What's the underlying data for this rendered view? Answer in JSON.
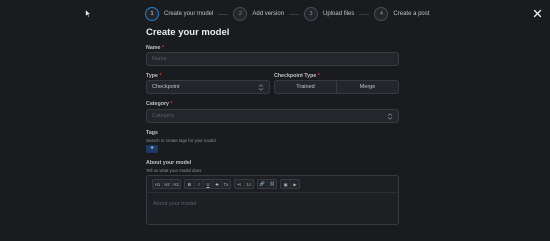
{
  "stepper": {
    "steps": [
      {
        "number": "1",
        "label": "Create your model"
      },
      {
        "number": "2",
        "label": "Add version"
      },
      {
        "number": "3",
        "label": "Upload files"
      },
      {
        "number": "4",
        "label": "Create a post"
      }
    ],
    "active_step": 1
  },
  "page_title": "Create your model",
  "form": {
    "name": {
      "label": "Name",
      "required_mark": "*",
      "placeholder": "Name"
    },
    "type": {
      "label": "Type",
      "required_mark": "*",
      "value": "Checkpoint"
    },
    "checkpoint_type": {
      "label": "Checkpoint Type",
      "required_mark": "*",
      "options": [
        "Trained",
        "Merge"
      ]
    },
    "category": {
      "label": "Category",
      "required_mark": "*",
      "placeholder": "Category"
    },
    "tags": {
      "label": "Tags",
      "description": "Search or create tags for your model",
      "add_label": "+"
    },
    "about": {
      "label": "About your model",
      "description": "Tell us what your model does",
      "placeholder": "About your model",
      "toolbar": {
        "headings": [
          "H1",
          "H2",
          "H3"
        ],
        "formatting": [
          "B",
          "I",
          "U",
          "S",
          "Tx"
        ],
        "lists": [
          "•≡",
          "1≡"
        ],
        "links": [
          "🔗",
          "⛓"
        ],
        "media": [
          "▣",
          "▶"
        ]
      }
    }
  },
  "colors": {
    "background": "#1a1b1e",
    "input_bg": "#25262b",
    "border": "#373a40",
    "accent": "#1c7ed6",
    "required": "#e03131"
  },
  "icons": {
    "close": "close-icon",
    "select": "chevron-updown-icon",
    "cursor": "mouse-pointer-icon"
  }
}
